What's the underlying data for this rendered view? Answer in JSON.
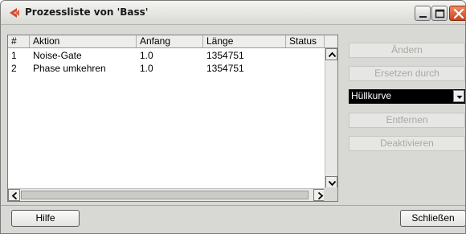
{
  "window": {
    "title": "Prozessliste von 'Bass'"
  },
  "table": {
    "headers": [
      "#",
      "Aktion",
      "Anfang",
      "Länge",
      "Status"
    ],
    "rows": [
      {
        "idx": "1",
        "aktion": "Noise-Gate",
        "anfang": "1.0",
        "laenge": "1354751",
        "status": ""
      },
      {
        "idx": "2",
        "aktion": "Phase umkehren",
        "anfang": "1.0",
        "laenge": "1354751",
        "status": ""
      }
    ]
  },
  "sidebar": {
    "aendern": "Ändern",
    "ersetzen": "Ersetzen durch",
    "dropdown_value": "Hüllkurve",
    "entfernen": "Entfernen",
    "deaktivieren": "Deaktivieren"
  },
  "footer": {
    "hilfe": "Hilfe",
    "schliessen": "Schließen"
  },
  "colors": {
    "logo": "#d24a2a",
    "close_button": "#d9552b",
    "disabled_text": "#a8a8a4",
    "dropdown_bg": "#000000"
  }
}
